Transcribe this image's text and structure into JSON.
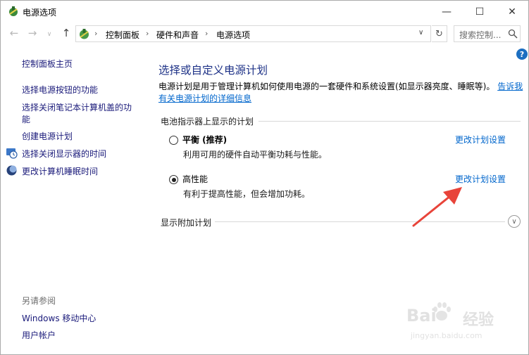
{
  "window": {
    "title": "电源选项",
    "minimize": "—",
    "maximize": "☐",
    "close": "✕"
  },
  "nav": {
    "back_icon": "arrow-left-icon",
    "forward_icon": "arrow-right-icon",
    "up_icon": "arrow-up-icon",
    "breadcrumb": [
      "控制面板",
      "硬件和声音",
      "电源选项"
    ],
    "search_placeholder": "搜索控制...",
    "refresh_icon": "refresh-icon"
  },
  "sidebar": {
    "items": [
      {
        "label": "控制面板主页"
      },
      {
        "label": "选择电源按钮的功能"
      },
      {
        "label": "选择关闭笔记本计算机盖的功"
      },
      {
        "label": "能"
      },
      {
        "label": "创建电源计划"
      },
      {
        "label": "选择关闭显示器的时间"
      },
      {
        "label": "更改计算机睡眠时间"
      }
    ],
    "see_also_heading": "另请参阅",
    "see_also": [
      {
        "label": "Windows 移动中心"
      },
      {
        "label": "用户帐户"
      }
    ]
  },
  "main": {
    "title": "选择或自定义电源计划",
    "description": "电源计划是用于管理计算机如何使用电源的一套硬件和系统设置(如显示器亮度、睡眠等)。",
    "description_link_1": "告诉我",
    "description_link_2": "有关电源计划的详细信息",
    "battery_section": "电池指示器上显示的计划",
    "plans": [
      {
        "name": "平衡 (推荐)",
        "description": "利用可用的硬件自动平衡功耗与性能。",
        "link": "更改计划设置",
        "selected": false
      },
      {
        "name": "高性能",
        "description": "有利于提高性能，但会增加功耗。",
        "link": "更改计划设置",
        "selected": true
      }
    ],
    "additional_section": "显示附加计划",
    "help": "?"
  },
  "watermark": {
    "brand": "Bai",
    "brand2": "经验",
    "url": "jingyan.baidu.com"
  },
  "colors": {
    "title_blue": "#1e3287",
    "link_blue": "#0066cc",
    "arrow_red": "#e8443a",
    "help_blue": "#1c6fc1"
  }
}
